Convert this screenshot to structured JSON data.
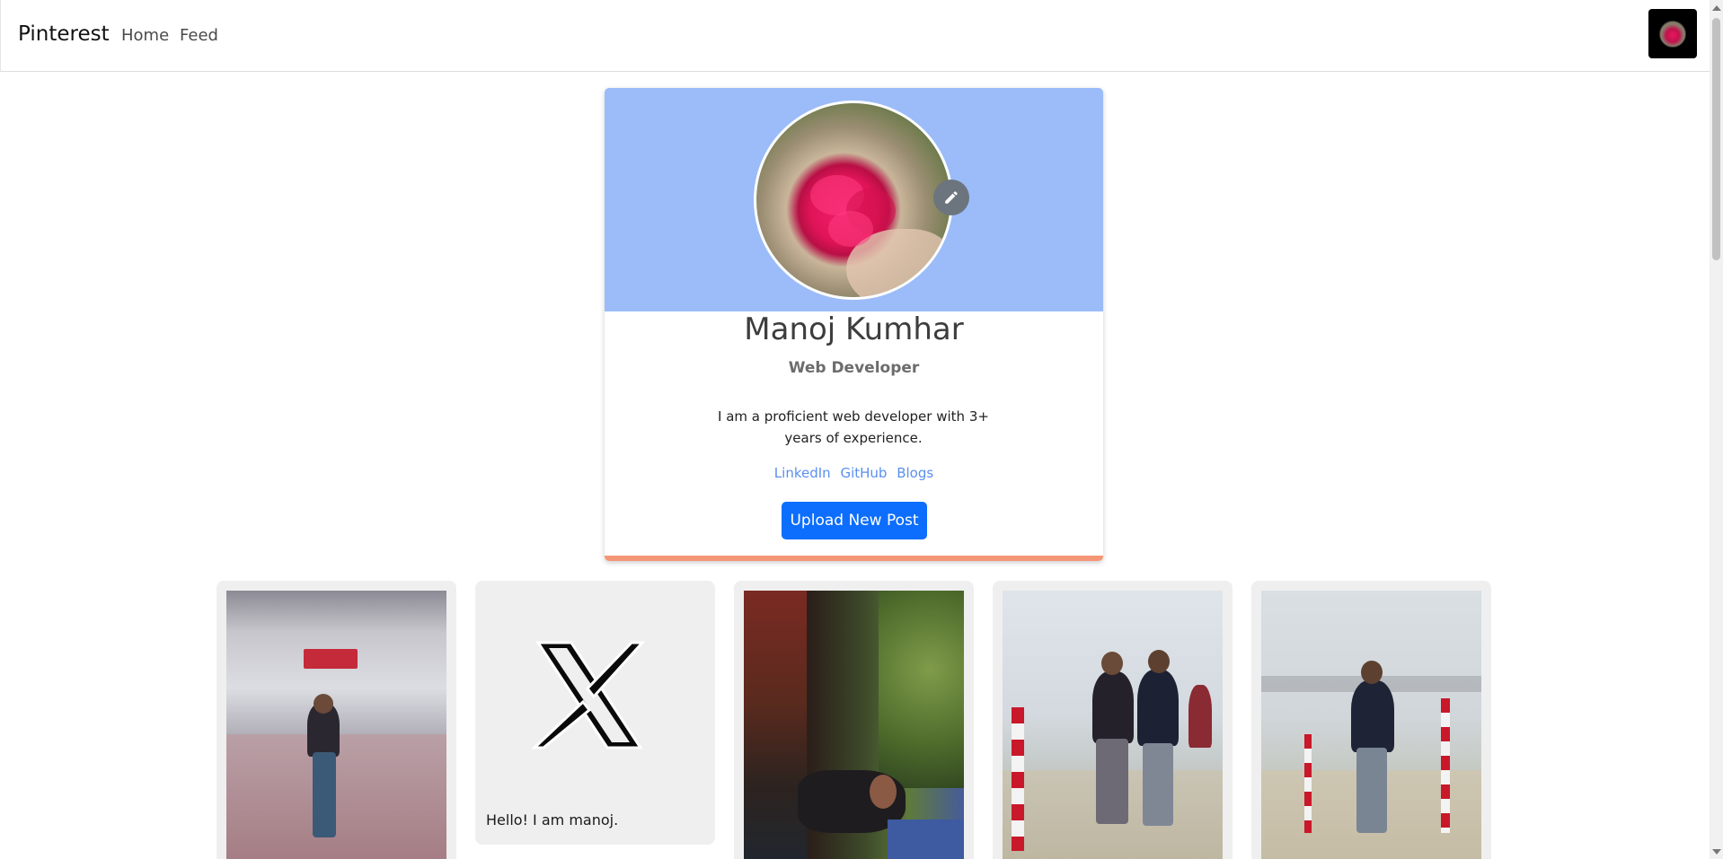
{
  "navbar": {
    "brand": "Pinterest",
    "links": [
      "Home",
      "Feed"
    ],
    "avatar_icon": "user-avatar"
  },
  "profile": {
    "name": "Manoj Kumhar",
    "role": "Web Developer",
    "bio": "I am a proficient web developer with 3+ years of experience.",
    "links": [
      "LinkedIn",
      "GitHub",
      "Blogs"
    ],
    "upload_label": "Upload New Post",
    "edit_icon": "pencil-icon",
    "header_color": "#9bbcf8",
    "accent_color": "#f59777",
    "button_color": "#0d6efd"
  },
  "posts": [
    {
      "caption": ""
    },
    {
      "caption": "Hello! I am manoj."
    },
    {
      "caption": ""
    },
    {
      "caption": ""
    },
    {
      "caption": ""
    }
  ]
}
